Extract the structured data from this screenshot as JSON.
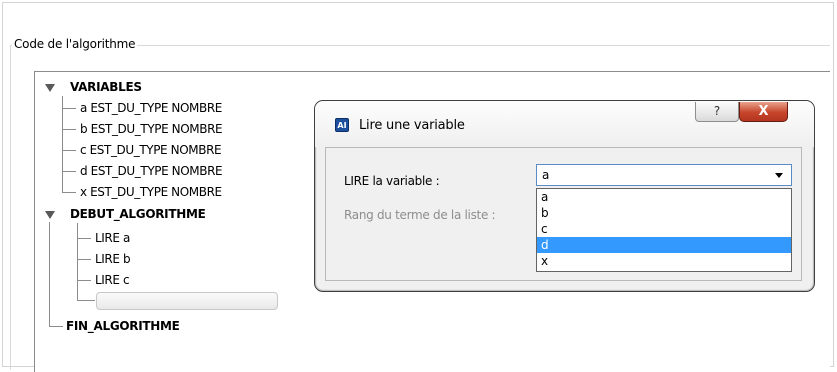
{
  "groupbox": {
    "title": "Code de l'algorithme"
  },
  "tree": {
    "variables_heading": "VARIABLES",
    "variables": [
      "a EST_DU_TYPE NOMBRE",
      "b EST_DU_TYPE NOMBRE",
      "c EST_DU_TYPE NOMBRE",
      "d EST_DU_TYPE NOMBRE",
      "x EST_DU_TYPE NOMBRE"
    ],
    "debut_heading": "DEBUT_ALGORITHME",
    "statements": [
      "LIRE a",
      "LIRE b",
      "LIRE c"
    ],
    "fin_heading": "FIN_ALGORITHME"
  },
  "dialog": {
    "title": "Lire une variable",
    "help_glyph": "?",
    "close_glyph": "X",
    "app_icon_text": "AI",
    "lire_label": "LIRE la variable :",
    "rang_label": "Rang du terme de la liste :",
    "selected_value": "a",
    "options": [
      "a",
      "b",
      "c",
      "d",
      "x"
    ],
    "highlighted_option": "d"
  },
  "icons": {
    "expand": "triangle-down-icon",
    "combo": "chevron-down-icon"
  },
  "colors": {
    "selection": "#3399ff",
    "close_button": "#c6452b",
    "combo_border": "#5c8ac7"
  }
}
